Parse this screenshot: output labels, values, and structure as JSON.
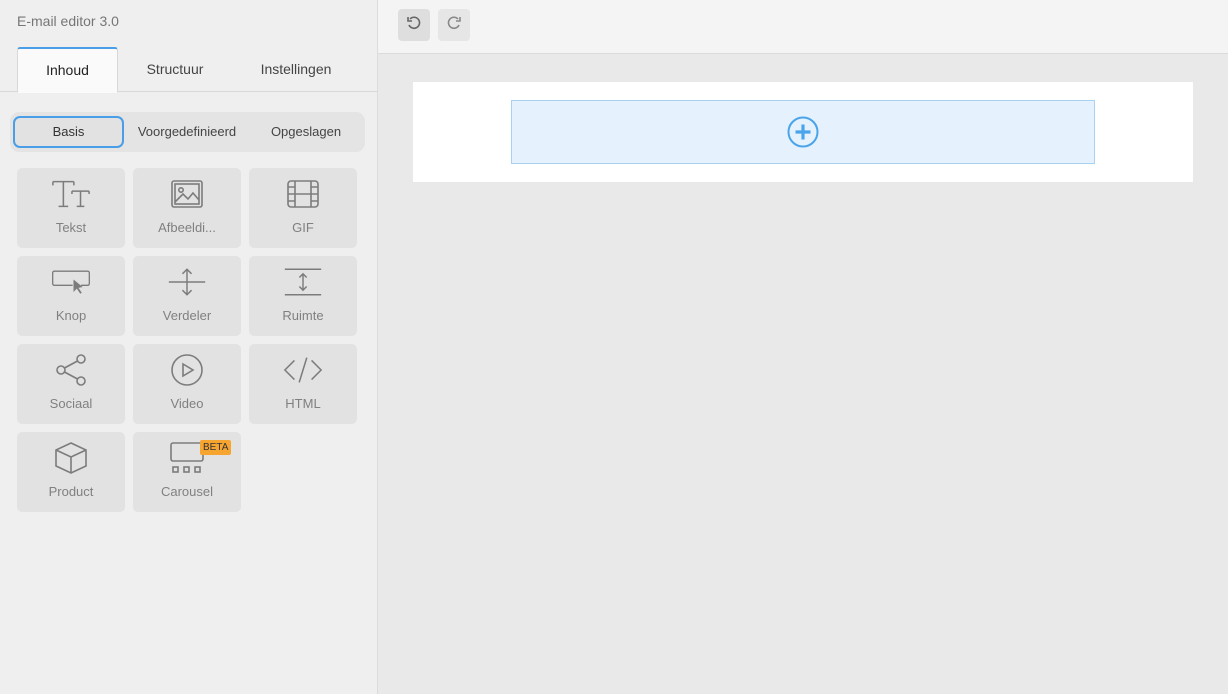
{
  "app": {
    "title": "E-mail editor 3.0"
  },
  "tabs": [
    {
      "label": "Inhoud"
    },
    {
      "label": "Structuur"
    },
    {
      "label": "Instellingen"
    }
  ],
  "segments": [
    {
      "label": "Basis"
    },
    {
      "label": "Voorgedefinieerd"
    },
    {
      "label": "Opgeslagen"
    }
  ],
  "blocks": [
    {
      "label": "Tekst",
      "icon": "text-icon"
    },
    {
      "label": "Afbeeldi...",
      "icon": "image-icon"
    },
    {
      "label": "GIF",
      "icon": "film-icon"
    },
    {
      "label": "Knop",
      "icon": "button-cursor-icon"
    },
    {
      "label": "Verdeler",
      "icon": "divider-icon"
    },
    {
      "label": "Ruimte",
      "icon": "spacer-icon"
    },
    {
      "label": "Sociaal",
      "icon": "share-icon"
    },
    {
      "label": "Video",
      "icon": "play-icon"
    },
    {
      "label": "HTML",
      "icon": "code-icon"
    },
    {
      "label": "Product",
      "icon": "box-icon"
    },
    {
      "label": "Carousel",
      "icon": "carousel-icon",
      "badge": "BETA"
    }
  ],
  "toolbar": {
    "undo_icon": "undo-icon",
    "redo_icon": "redo-icon"
  },
  "colors": {
    "accent": "#4a9ee8",
    "drop_bg": "#e5f2fe",
    "badge": "#f7a531"
  }
}
